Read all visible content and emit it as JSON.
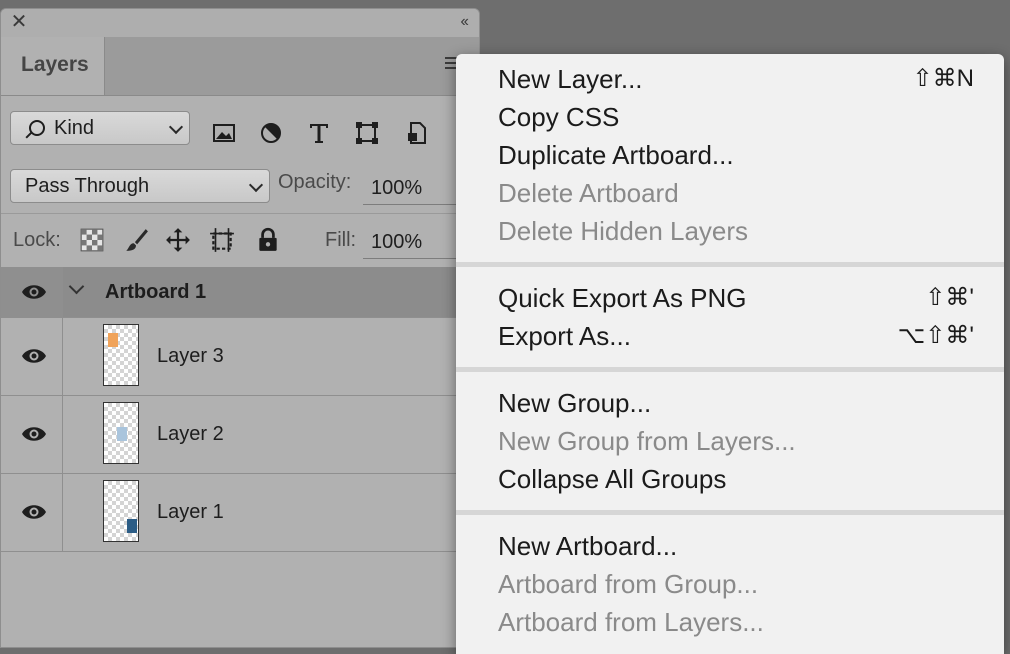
{
  "panel": {
    "tab_label": "Layers",
    "close_glyph": "✕",
    "collapse_glyph": "‹‹",
    "kind_label": "Kind",
    "blend_mode": "Pass Through",
    "opacity_label": "Opacity:",
    "opacity_value": "100%",
    "lock_label": "Lock:",
    "fill_label": "Fill:",
    "fill_value": "100%",
    "filter_icons": [
      "image-filter-icon",
      "adjustment-filter-icon",
      "type-filter-icon",
      "shape-filter-icon",
      "smart-object-filter-icon"
    ],
    "lock_icons": [
      "lock-transparent-icon",
      "lock-image-icon",
      "lock-position-icon",
      "lock-artboard-icon",
      "lock-all-icon"
    ]
  },
  "layers": {
    "artboard": "Artboard 1",
    "items": [
      {
        "name": "Layer 3",
        "swatch": "#f0a35a"
      },
      {
        "name": "Layer 2",
        "swatch": "#a9c4dc"
      },
      {
        "name": "Layer 1",
        "swatch": "#2c5d86"
      }
    ]
  },
  "menu": {
    "groups": [
      [
        {
          "label": "New Layer...",
          "shortcut": "⇧⌘N",
          "enabled": true
        },
        {
          "label": "Copy CSS",
          "shortcut": "",
          "enabled": true
        },
        {
          "label": "Duplicate Artboard...",
          "shortcut": "",
          "enabled": true
        },
        {
          "label": "Delete Artboard",
          "shortcut": "",
          "enabled": false
        },
        {
          "label": "Delete Hidden Layers",
          "shortcut": "",
          "enabled": false
        }
      ],
      [
        {
          "label": "Quick Export As PNG",
          "shortcut": "⇧⌘'",
          "enabled": true
        },
        {
          "label": "Export As...",
          "shortcut": "⌥⇧⌘'",
          "enabled": true
        }
      ],
      [
        {
          "label": "New Group...",
          "shortcut": "",
          "enabled": true
        },
        {
          "label": "New Group from Layers...",
          "shortcut": "",
          "enabled": false
        },
        {
          "label": "Collapse All Groups",
          "shortcut": "",
          "enabled": true
        }
      ],
      [
        {
          "label": "New Artboard...",
          "shortcut": "",
          "enabled": true
        },
        {
          "label": "Artboard from Group...",
          "shortcut": "",
          "enabled": false
        },
        {
          "label": "Artboard from Layers...",
          "shortcut": "",
          "enabled": false
        }
      ]
    ]
  }
}
